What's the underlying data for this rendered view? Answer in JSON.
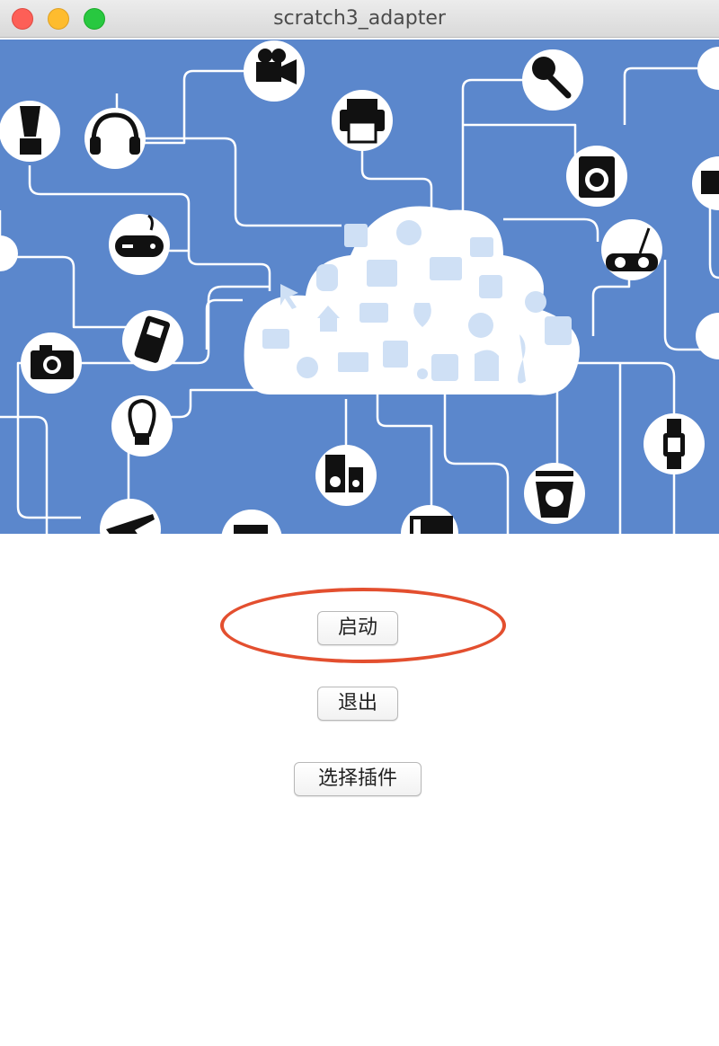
{
  "window": {
    "title": "scratch3_adapter",
    "controls": [
      "close",
      "minimize",
      "zoom"
    ]
  },
  "banner": {
    "description_icons": [
      "camcorder-icon",
      "microphone-icon",
      "printer-icon",
      "blender-icon",
      "headset-icon",
      "washing-machine-icon",
      "gamepad-icon",
      "radio-icon",
      "mobile-phone-icon",
      "camera-icon",
      "light-bulb-icon",
      "speaker-icon",
      "kitchen-scale-icon",
      "watch-icon",
      "airplane-icon",
      "cloud-icon"
    ],
    "colors": {
      "background": "#5b87cc",
      "lines": "#ffffff",
      "cloud": "#ffffff",
      "cloud_glyphs": "#cfe0f5"
    }
  },
  "buttons": {
    "start_label": "启动",
    "exit_label": "退出",
    "plugin_label": "选择插件"
  },
  "annotation": {
    "color": "#e34f2f"
  }
}
